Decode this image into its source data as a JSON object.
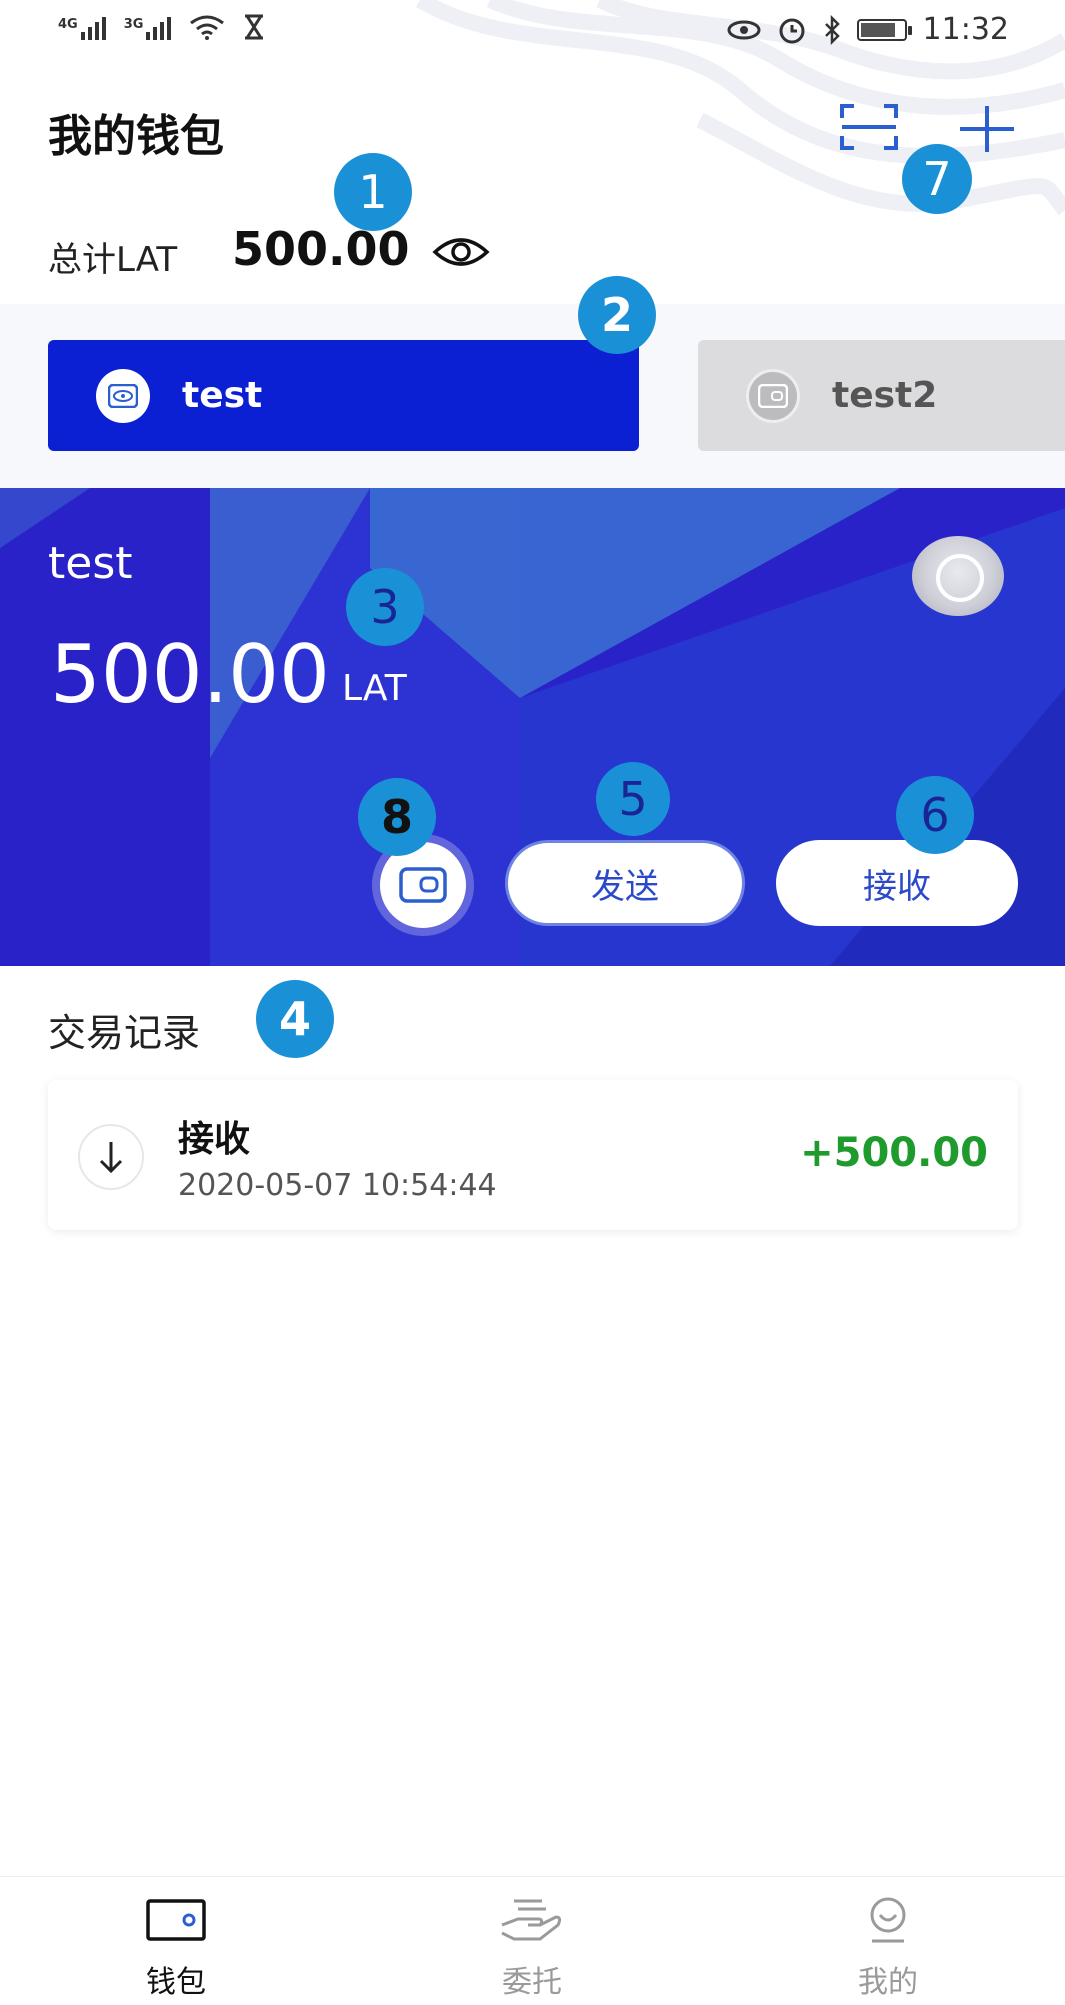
{
  "status_bar": {
    "network1": "4G",
    "network2": "3G",
    "time": "11:32"
  },
  "header": {
    "title": "我的钱包",
    "total_label": "总计LAT",
    "total_value": "500.00"
  },
  "wallet_tabs": [
    {
      "name": "test",
      "active": true
    },
    {
      "name": "test2",
      "active": false
    }
  ],
  "wallet_card": {
    "name": "test",
    "balance": "500.00",
    "unit": "LAT",
    "send_label": "发送",
    "receive_label": "接收"
  },
  "transactions": {
    "title": "交易记录",
    "items": [
      {
        "type": "接收",
        "time": "2020-05-07 10:54:44",
        "amount": "+500.00"
      }
    ]
  },
  "markers": [
    "1",
    "2",
    "3",
    "4",
    "5",
    "6",
    "7",
    "8"
  ],
  "bottom_nav": [
    {
      "label": "钱包",
      "active": true
    },
    {
      "label": "委托",
      "active": false
    },
    {
      "label": "我的",
      "active": false
    }
  ],
  "colors": {
    "primary": "#0b1fd3",
    "card_bg": "#2a22c9",
    "positive": "#1f9a2c",
    "marker": "#1a91d6"
  }
}
